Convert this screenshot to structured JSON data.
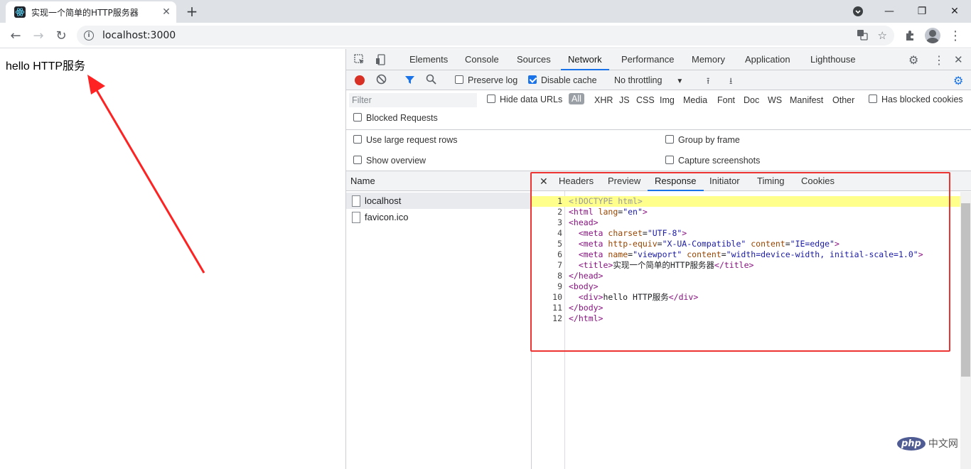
{
  "browser": {
    "tab_title": "实现一个简单的HTTP服务器",
    "address": "localhost:3000"
  },
  "page": {
    "body_text": "hello HTTP服务"
  },
  "devtools": {
    "tabs": [
      "Elements",
      "Console",
      "Sources",
      "Network",
      "Performance",
      "Memory",
      "Application",
      "Lighthouse"
    ],
    "active_tab": "Network",
    "toolbar": {
      "preserve_log": "Preserve log",
      "disable_cache": "Disable cache",
      "throttling": "No throttling"
    },
    "filter": {
      "placeholder": "Filter",
      "hide_data_urls": "Hide data URLs",
      "types": [
        "All",
        "XHR",
        "JS",
        "CSS",
        "Img",
        "Media",
        "Font",
        "Doc",
        "WS",
        "Manifest",
        "Other"
      ],
      "has_blocked_cookies": "Has blocked cookies",
      "blocked_requests": "Blocked Requests"
    },
    "settings": {
      "large_rows": "Use large request rows",
      "group_by_frame": "Group by frame",
      "show_overview": "Show overview",
      "capture_screenshots": "Capture screenshots"
    },
    "requests": {
      "header": "Name",
      "items": [
        "localhost",
        "favicon.ico"
      ]
    },
    "detail": {
      "tabs": [
        "Headers",
        "Preview",
        "Response",
        "Initiator",
        "Timing",
        "Cookies"
      ],
      "active": "Response",
      "line_numbers": [
        "1",
        "2",
        "3",
        "4",
        "5",
        "6",
        "7",
        "8",
        "9",
        "10",
        "11",
        "12"
      ]
    }
  },
  "watermark": {
    "logo": "php",
    "text": "中文网"
  },
  "colors": {
    "accent": "#1a73e8",
    "highlight": "#e33",
    "record": "#d93025"
  }
}
